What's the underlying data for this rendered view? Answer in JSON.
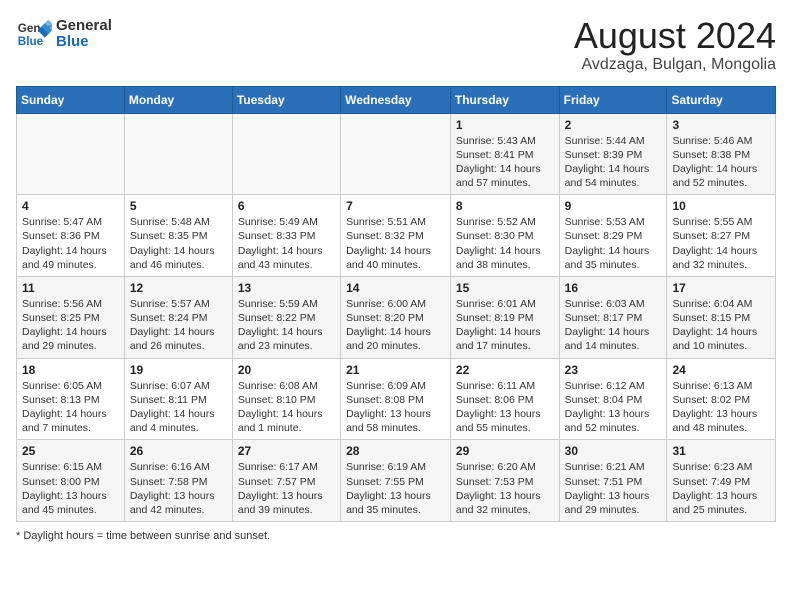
{
  "logo": {
    "general": "General",
    "blue": "Blue"
  },
  "header": {
    "month_year": "August 2024",
    "location": "Avdzaga, Bulgan, Mongolia"
  },
  "days_of_week": [
    "Sunday",
    "Monday",
    "Tuesday",
    "Wednesday",
    "Thursday",
    "Friday",
    "Saturday"
  ],
  "weeks": [
    [
      {
        "day": "",
        "info": ""
      },
      {
        "day": "",
        "info": ""
      },
      {
        "day": "",
        "info": ""
      },
      {
        "day": "",
        "info": ""
      },
      {
        "day": "1",
        "info": "Sunrise: 5:43 AM\nSunset: 8:41 PM\nDaylight: 14 hours and 57 minutes."
      },
      {
        "day": "2",
        "info": "Sunrise: 5:44 AM\nSunset: 8:39 PM\nDaylight: 14 hours and 54 minutes."
      },
      {
        "day": "3",
        "info": "Sunrise: 5:46 AM\nSunset: 8:38 PM\nDaylight: 14 hours and 52 minutes."
      }
    ],
    [
      {
        "day": "4",
        "info": "Sunrise: 5:47 AM\nSunset: 8:36 PM\nDaylight: 14 hours and 49 minutes."
      },
      {
        "day": "5",
        "info": "Sunrise: 5:48 AM\nSunset: 8:35 PM\nDaylight: 14 hours and 46 minutes."
      },
      {
        "day": "6",
        "info": "Sunrise: 5:49 AM\nSunset: 8:33 PM\nDaylight: 14 hours and 43 minutes."
      },
      {
        "day": "7",
        "info": "Sunrise: 5:51 AM\nSunset: 8:32 PM\nDaylight: 14 hours and 40 minutes."
      },
      {
        "day": "8",
        "info": "Sunrise: 5:52 AM\nSunset: 8:30 PM\nDaylight: 14 hours and 38 minutes."
      },
      {
        "day": "9",
        "info": "Sunrise: 5:53 AM\nSunset: 8:29 PM\nDaylight: 14 hours and 35 minutes."
      },
      {
        "day": "10",
        "info": "Sunrise: 5:55 AM\nSunset: 8:27 PM\nDaylight: 14 hours and 32 minutes."
      }
    ],
    [
      {
        "day": "11",
        "info": "Sunrise: 5:56 AM\nSunset: 8:25 PM\nDaylight: 14 hours and 29 minutes."
      },
      {
        "day": "12",
        "info": "Sunrise: 5:57 AM\nSunset: 8:24 PM\nDaylight: 14 hours and 26 minutes."
      },
      {
        "day": "13",
        "info": "Sunrise: 5:59 AM\nSunset: 8:22 PM\nDaylight: 14 hours and 23 minutes."
      },
      {
        "day": "14",
        "info": "Sunrise: 6:00 AM\nSunset: 8:20 PM\nDaylight: 14 hours and 20 minutes."
      },
      {
        "day": "15",
        "info": "Sunrise: 6:01 AM\nSunset: 8:19 PM\nDaylight: 14 hours and 17 minutes."
      },
      {
        "day": "16",
        "info": "Sunrise: 6:03 AM\nSunset: 8:17 PM\nDaylight: 14 hours and 14 minutes."
      },
      {
        "day": "17",
        "info": "Sunrise: 6:04 AM\nSunset: 8:15 PM\nDaylight: 14 hours and 10 minutes."
      }
    ],
    [
      {
        "day": "18",
        "info": "Sunrise: 6:05 AM\nSunset: 8:13 PM\nDaylight: 14 hours and 7 minutes."
      },
      {
        "day": "19",
        "info": "Sunrise: 6:07 AM\nSunset: 8:11 PM\nDaylight: 14 hours and 4 minutes."
      },
      {
        "day": "20",
        "info": "Sunrise: 6:08 AM\nSunset: 8:10 PM\nDaylight: 14 hours and 1 minute."
      },
      {
        "day": "21",
        "info": "Sunrise: 6:09 AM\nSunset: 8:08 PM\nDaylight: 13 hours and 58 minutes."
      },
      {
        "day": "22",
        "info": "Sunrise: 6:11 AM\nSunset: 8:06 PM\nDaylight: 13 hours and 55 minutes."
      },
      {
        "day": "23",
        "info": "Sunrise: 6:12 AM\nSunset: 8:04 PM\nDaylight: 13 hours and 52 minutes."
      },
      {
        "day": "24",
        "info": "Sunrise: 6:13 AM\nSunset: 8:02 PM\nDaylight: 13 hours and 48 minutes."
      }
    ],
    [
      {
        "day": "25",
        "info": "Sunrise: 6:15 AM\nSunset: 8:00 PM\nDaylight: 13 hours and 45 minutes."
      },
      {
        "day": "26",
        "info": "Sunrise: 6:16 AM\nSunset: 7:58 PM\nDaylight: 13 hours and 42 minutes."
      },
      {
        "day": "27",
        "info": "Sunrise: 6:17 AM\nSunset: 7:57 PM\nDaylight: 13 hours and 39 minutes."
      },
      {
        "day": "28",
        "info": "Sunrise: 6:19 AM\nSunset: 7:55 PM\nDaylight: 13 hours and 35 minutes."
      },
      {
        "day": "29",
        "info": "Sunrise: 6:20 AM\nSunset: 7:53 PM\nDaylight: 13 hours and 32 minutes."
      },
      {
        "day": "30",
        "info": "Sunrise: 6:21 AM\nSunset: 7:51 PM\nDaylight: 13 hours and 29 minutes."
      },
      {
        "day": "31",
        "info": "Sunrise: 6:23 AM\nSunset: 7:49 PM\nDaylight: 13 hours and 25 minutes."
      }
    ]
  ],
  "footer": {
    "daylight_label": "Daylight hours"
  }
}
